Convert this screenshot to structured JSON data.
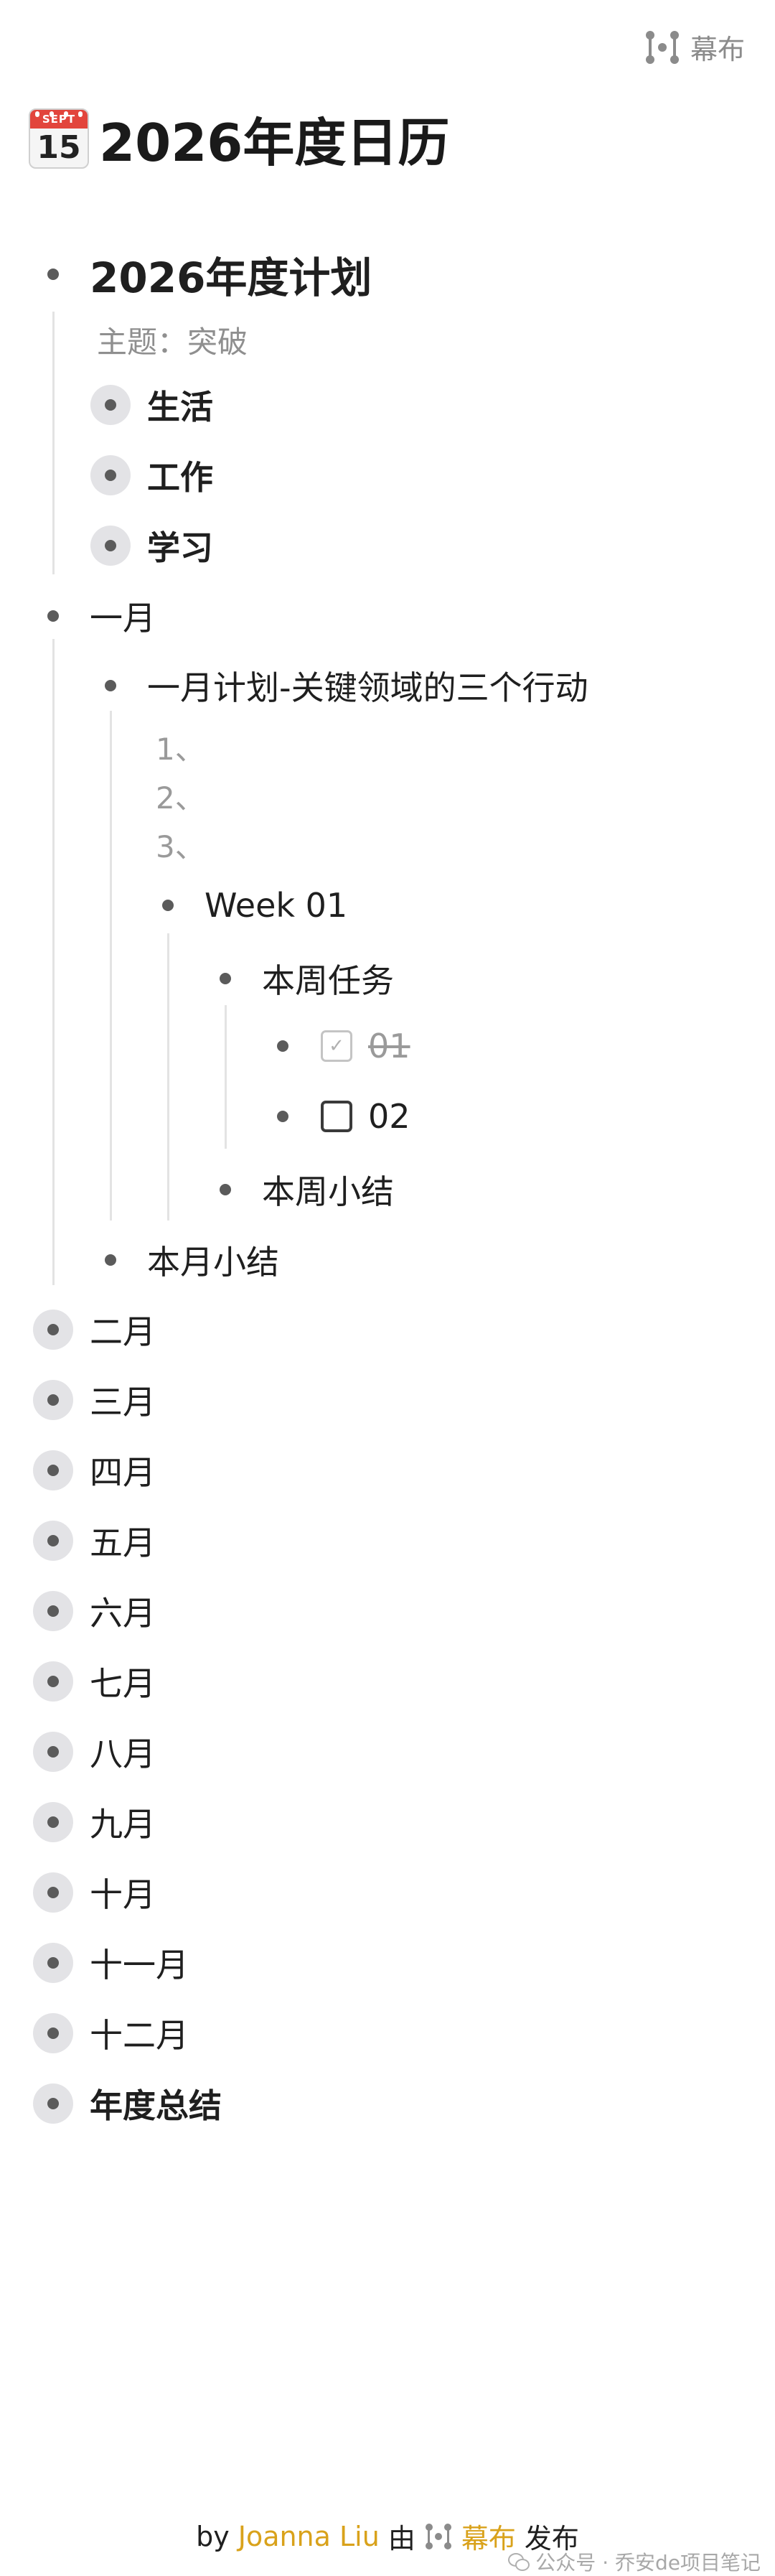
{
  "brand": {
    "name": "幕布"
  },
  "page": {
    "title": "2026年度日历",
    "calendar_icon_month": "SEPT",
    "calendar_icon_day": "15"
  },
  "outline": {
    "plan": {
      "title": "2026年度计划",
      "note": "主题：突破",
      "children": [
        "生活",
        "工作",
        "学习"
      ]
    },
    "january": {
      "title": "一月",
      "plan_title": "一月计划-关键领域的三个行动",
      "actions": [
        "1、",
        "2、",
        "3、"
      ],
      "week": {
        "title": "Week 01",
        "tasks_title": "本周任务",
        "tasks": [
          {
            "label": "01",
            "checked": true
          },
          {
            "label": "02",
            "checked": false
          }
        ],
        "summary": "本周小结"
      },
      "summary": "本月小结"
    },
    "months": [
      "二月",
      "三月",
      "四月",
      "五月",
      "六月",
      "七月",
      "八月",
      "九月",
      "十月",
      "十一月",
      "十二月"
    ],
    "year_summary": "年度总结"
  },
  "footer": {
    "by": "by",
    "author": "Joanna Liu",
    "via": "由",
    "app": "幕布",
    "published": "发布"
  },
  "watermark": "公众号 · 乔安de项目笔记",
  "colors": {
    "accent": "#d9a21b",
    "bullet": "#5b5b5b",
    "collapsed_ring": "#e3e3e6",
    "guide_line": "#e3e3e3"
  }
}
